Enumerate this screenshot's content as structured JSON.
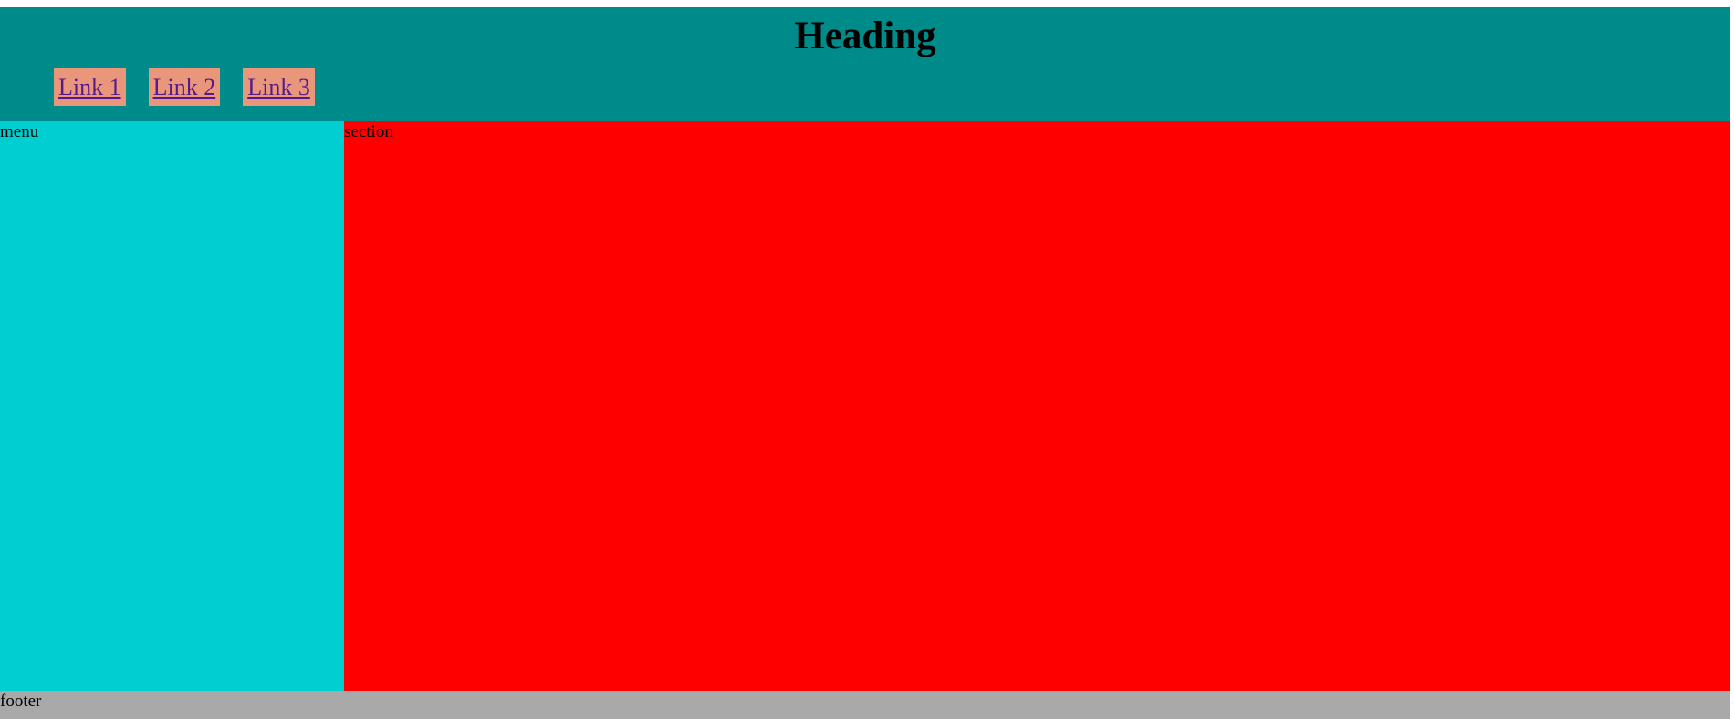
{
  "header": {
    "heading": "Heading",
    "nav_links": [
      "Link 1",
      "Link 2",
      "Link 3"
    ]
  },
  "menu": {
    "label": "menu"
  },
  "section": {
    "label": "section"
  },
  "footer": {
    "label": "footer"
  },
  "colors": {
    "header_bg": "#008b8b",
    "link_bg": "#e9967a",
    "link_text": "#551a8b",
    "menu_bg": "#00ced1",
    "section_bg": "#ff0000",
    "footer_bg": "#a9a9a9"
  }
}
